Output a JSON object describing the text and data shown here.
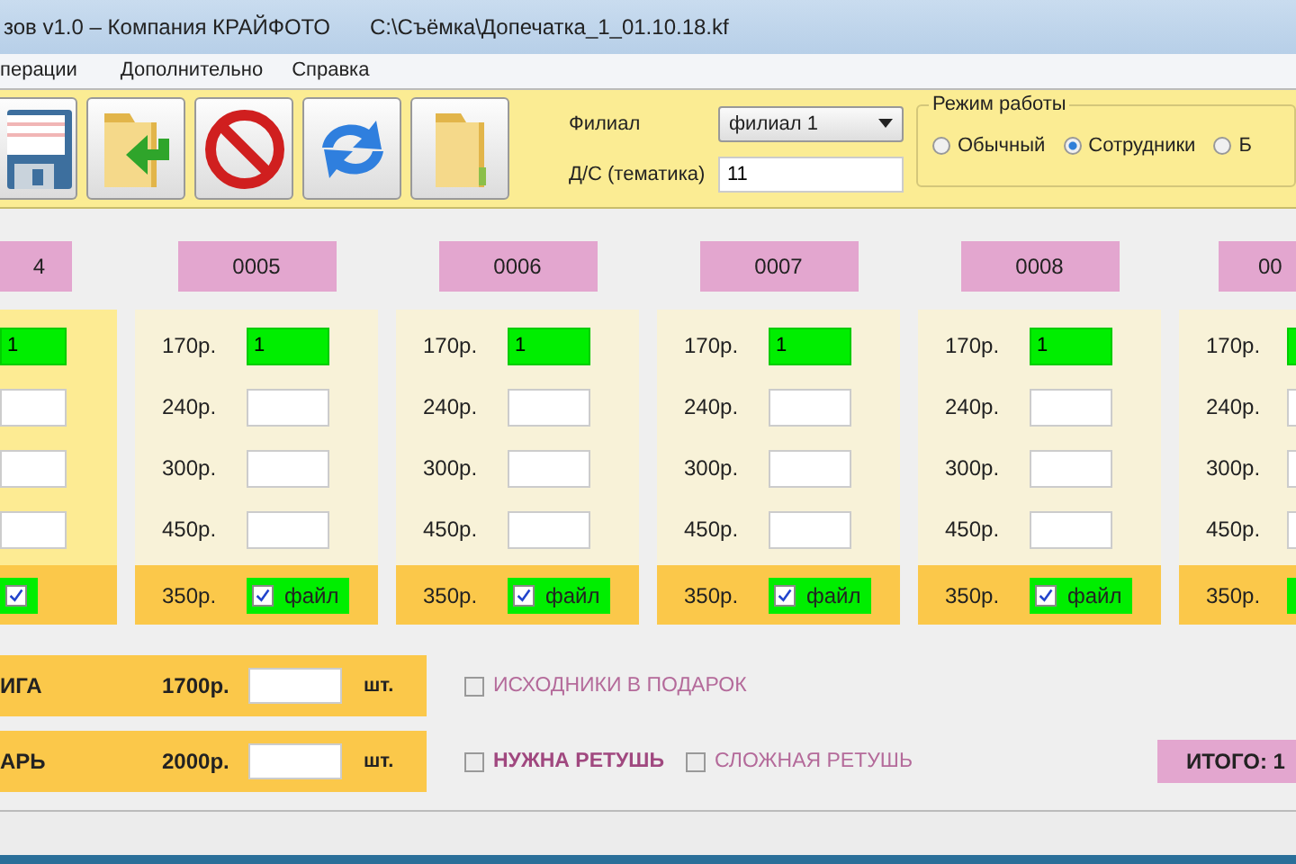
{
  "window": {
    "title": "зов v1.0 – Компания КРАЙФОТО",
    "path": "C:\\Съёмка\\Допечатка_1_01.10.18.kf"
  },
  "menu": [
    "перации",
    "Дополнительно",
    "Справка"
  ],
  "toolbar": [
    {
      "kind": "save"
    },
    {
      "kind": "import"
    },
    {
      "kind": "cancel"
    },
    {
      "kind": "refresh"
    },
    {
      "kind": "folder"
    }
  ],
  "branch": {
    "label": "Филиал",
    "value": "филиал 1"
  },
  "theme": {
    "label": "Д/С (тематика)",
    "value": "11"
  },
  "mode": {
    "title": "Режим работы",
    "options": [
      {
        "label": "Обычный",
        "selected": false
      },
      {
        "label": "Сотрудники",
        "selected": true
      },
      {
        "label": "Б",
        "selected": false
      }
    ]
  },
  "cards": [
    {
      "kind": "clip-left",
      "number": "4",
      "selected": true,
      "rows": [
        {
          "value": "1",
          "filled": true
        },
        {
          "filled": false
        },
        {
          "filled": false
        },
        {
          "filled": false
        }
      ],
      "file": {
        "checked": true
      }
    },
    {
      "kind": "full",
      "number": "0005",
      "selected": false,
      "rows": [
        {
          "price": "170р.",
          "value": "1"
        },
        {
          "price": "240р.",
          "value": ""
        },
        {
          "price": "300р.",
          "value": ""
        },
        {
          "price": "450р.",
          "value": ""
        }
      ],
      "file": {
        "price": "350р.",
        "checked": true,
        "label": "файл"
      }
    },
    {
      "kind": "full",
      "number": "0006",
      "selected": false,
      "rows": [
        {
          "price": "170р.",
          "value": "1"
        },
        {
          "price": "240р.",
          "value": ""
        },
        {
          "price": "300р.",
          "value": ""
        },
        {
          "price": "450р.",
          "value": ""
        }
      ],
      "file": {
        "price": "350р.",
        "checked": true,
        "label": "файл"
      }
    },
    {
      "kind": "full",
      "number": "0007",
      "selected": false,
      "rows": [
        {
          "price": "170р.",
          "value": "1"
        },
        {
          "price": "240р.",
          "value": ""
        },
        {
          "price": "300р.",
          "value": ""
        },
        {
          "price": "450р.",
          "value": ""
        }
      ],
      "file": {
        "price": "350р.",
        "checked": true,
        "label": "файл"
      }
    },
    {
      "kind": "full",
      "number": "0008",
      "selected": false,
      "rows": [
        {
          "price": "170р.",
          "value": "1"
        },
        {
          "price": "240р.",
          "value": ""
        },
        {
          "price": "300р.",
          "value": ""
        },
        {
          "price": "450р.",
          "value": ""
        }
      ],
      "file": {
        "price": "350р.",
        "checked": true,
        "label": "файл"
      }
    },
    {
      "kind": "clip-right",
      "number": "00",
      "selected": false,
      "rows": [
        {
          "price": "170р.",
          "filled": true
        },
        {
          "price": "240р.",
          "filled": false
        },
        {
          "price": "300р.",
          "filled": false
        },
        {
          "price": "450р.",
          "filled": false
        }
      ],
      "file": {
        "price": "350р."
      }
    }
  ],
  "extras": [
    {
      "name": "ИГА",
      "price": "1700р.",
      "unit": "шт.",
      "options": [
        {
          "label": "ИСХОДНИКИ В ПОДАРОК",
          "checked": false,
          "bold": false
        }
      ]
    },
    {
      "name": "АРЬ",
      "price": "2000р.",
      "unit": "шт.",
      "options": [
        {
          "label": "НУЖНА РЕТУШЬ",
          "checked": false,
          "bold": true
        },
        {
          "label": "СЛОЖНАЯ РЕТУШЬ",
          "checked": false,
          "bold": false
        }
      ]
    }
  ],
  "total": "ИТОГО: 1"
}
